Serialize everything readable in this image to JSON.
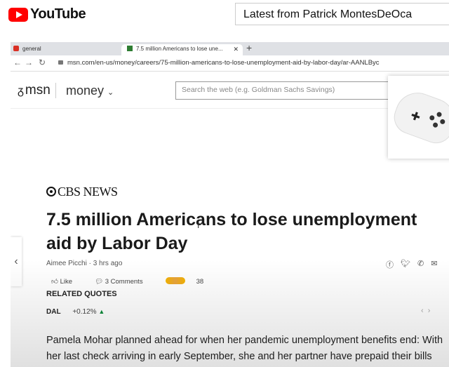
{
  "youtube": {
    "brand": "YouTube",
    "search_value": "Latest from Patrick MontesDeOca"
  },
  "browser": {
    "tabs": [
      {
        "title": "general"
      },
      {
        "title": "7.5 million Americans to lose une..."
      }
    ],
    "url": "msn.com/en-us/money/careers/75-million-americans-to-lose-unemployment-aid-by-labor-day/ar-AANLByc"
  },
  "msn": {
    "logo": "msn",
    "section": "money",
    "search_placeholder": "Search the web (e.g. Goldman Sachs Savings)"
  },
  "article": {
    "source": "CBS NEWS",
    "headline": "7.5 million Americans to lose unemployment aid by Labor Day",
    "author": "Aimee Picchi",
    "time": "3 hrs ago",
    "like_label": "Like",
    "comments_label": "3 Comments",
    "reactions_count": "38",
    "related_quotes_label": "RELATED QUOTES",
    "quote_symbol": "DAL",
    "quote_change": "+0.12%",
    "body": "Pamela Mohar planned ahead for when her pandemic unemployment benefits end: With her last check arriving in early September, she and her partner have prepaid their bills"
  },
  "colors": {
    "youtube_red": "#ff0000",
    "quote_up": "#0a8a3a"
  }
}
